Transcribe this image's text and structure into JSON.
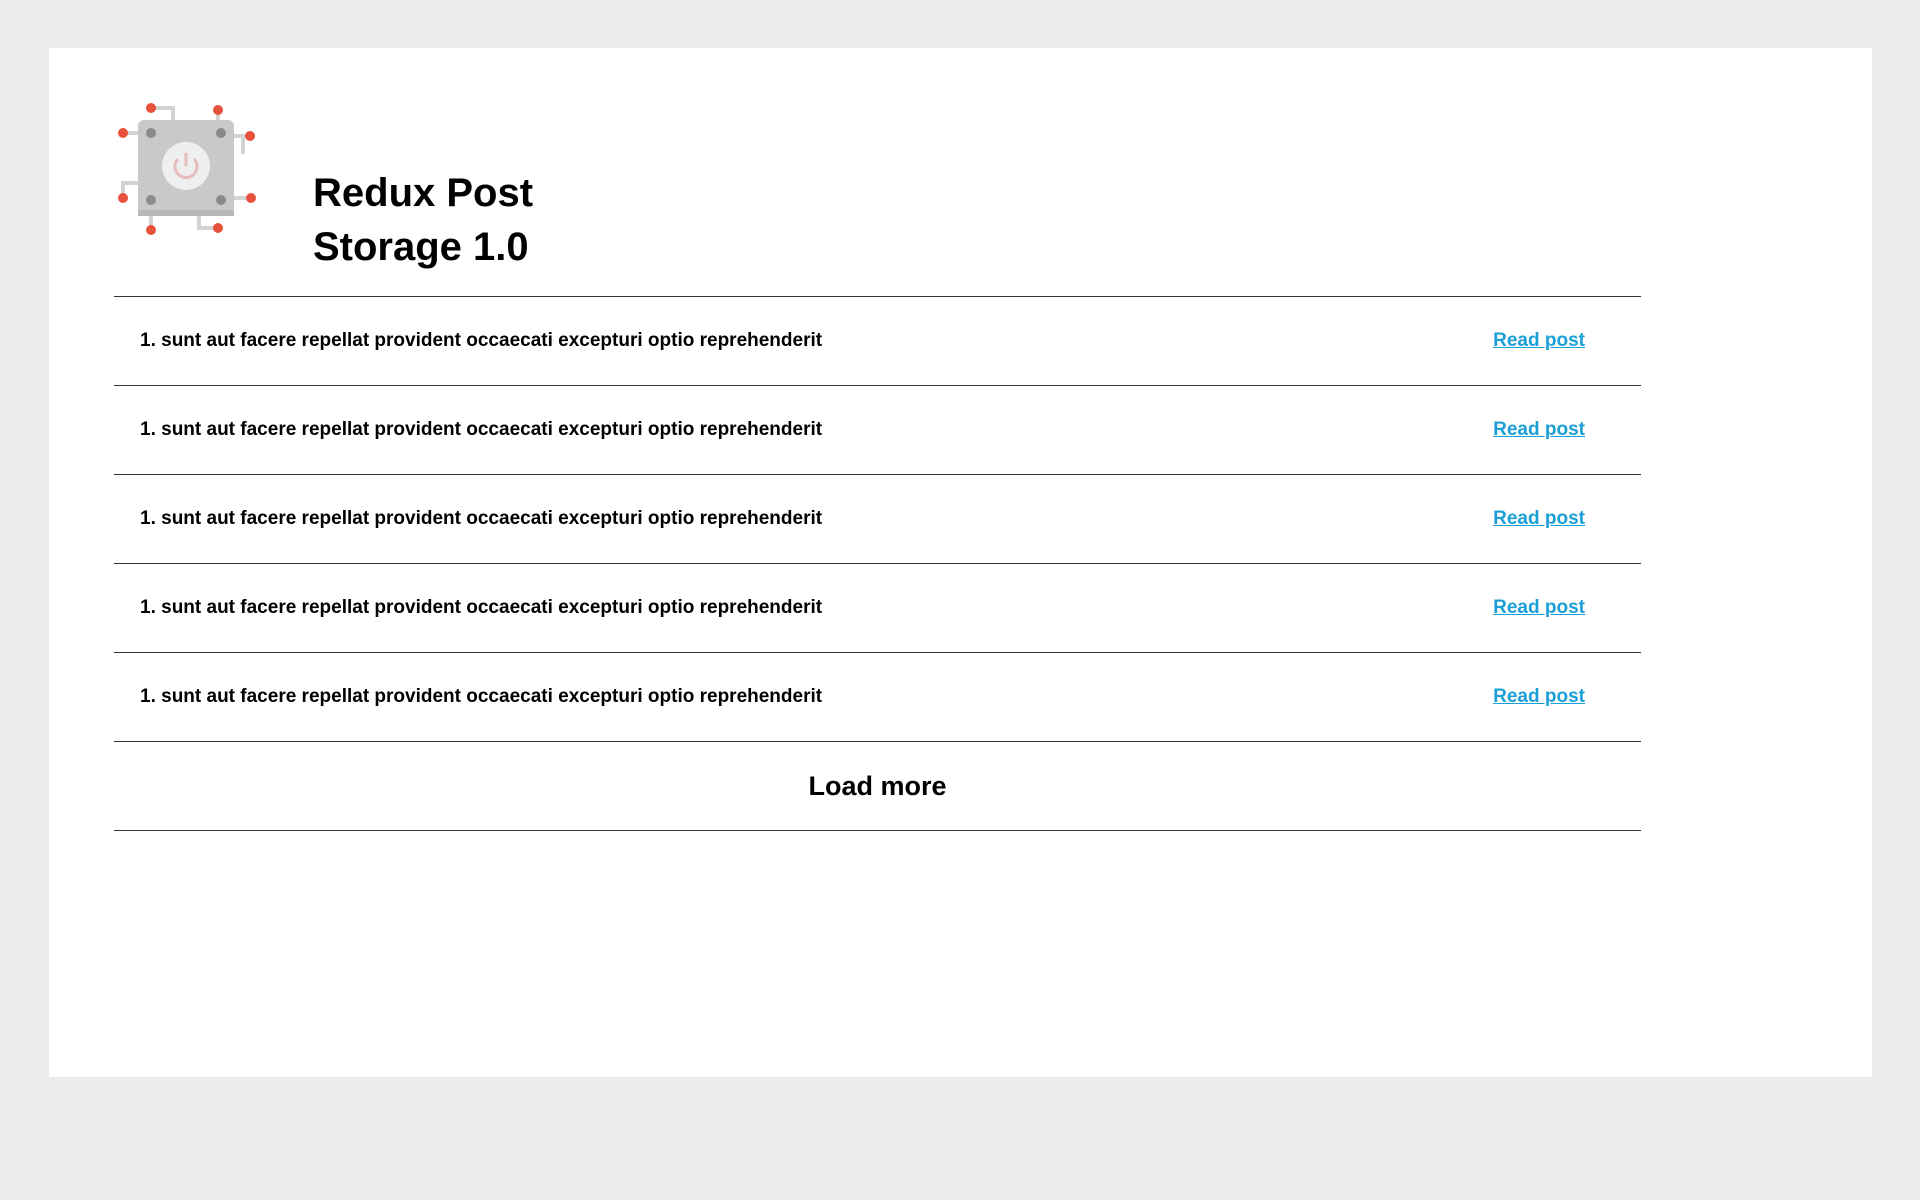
{
  "header": {
    "title": "Redux Post\nStorage 1.0",
    "logo_icon": "chip-power-icon"
  },
  "posts": [
    {
      "title": "1. sunt aut facere repellat provident occaecati excepturi optio reprehenderit",
      "link_label": "Read post"
    },
    {
      "title": "1. sunt aut facere repellat provident occaecati excepturi optio reprehenderit",
      "link_label": "Read post"
    },
    {
      "title": "1. sunt aut facere repellat provident occaecati excepturi optio reprehenderit",
      "link_label": "Read post"
    },
    {
      "title": "1. sunt aut facere repellat provident occaecati excepturi optio reprehenderit",
      "link_label": "Read post"
    },
    {
      "title": "1. sunt aut facere repellat provident occaecati excepturi optio reprehenderit",
      "link_label": "Read post"
    }
  ],
  "load_more_label": "Load more",
  "colors": {
    "background": "#ececec",
    "card": "#ffffff",
    "link": "#1a9fd6",
    "logo_dot": "#e8513b",
    "chip": "#c9c9c9"
  }
}
